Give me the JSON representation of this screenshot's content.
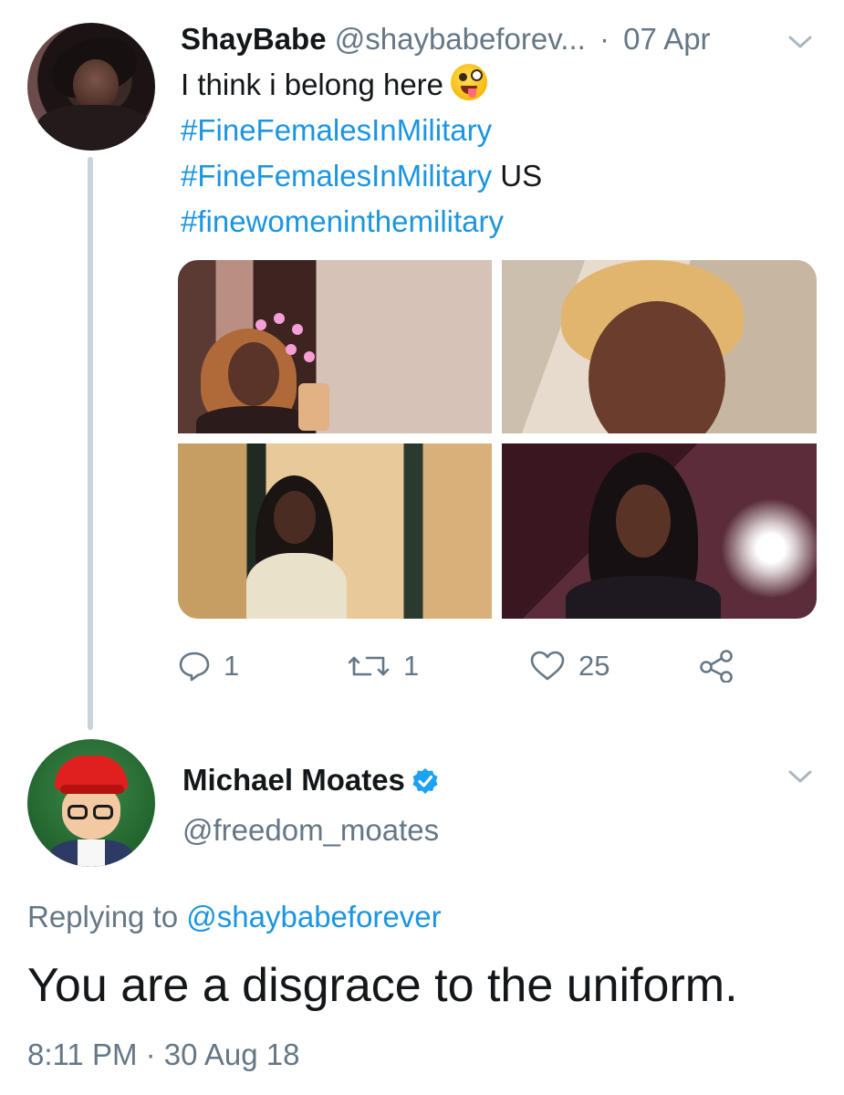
{
  "tweet1": {
    "author_name": "ShayBabe",
    "handle": "@shaybabeforev...",
    "separator": "·",
    "date": "07 Apr",
    "text_line1": "I think i belong here",
    "emoji": "zany-face",
    "hashtags": [
      "#FineFemalesInMilitary",
      "#FineFemalesInMilitary",
      "#finewomeninthemilitary"
    ],
    "hashtag2_suffix": "US",
    "photos": [
      "photo-mirror-selfie-hearts",
      "photo-car-selfie",
      "photo-mirror-selfie",
      "photo-flash-selfie"
    ],
    "actions": {
      "replies": "1",
      "retweets": "1",
      "likes": "25"
    }
  },
  "tweet2": {
    "author_name": "Michael Moates",
    "verified": true,
    "handle": "@freedom_moates",
    "replying_prefix": "Replying to",
    "replying_handle": "@shaybabeforever",
    "text": "You are a disgrace to the uniform.",
    "timestamp": "8:11 PM · 30 Aug 18"
  },
  "colors": {
    "link": "#1b95e0",
    "secondary_text": "#657786",
    "primary_text": "#14171a",
    "thread_line": "#c8d3dc",
    "verified": "#1da1f2"
  }
}
